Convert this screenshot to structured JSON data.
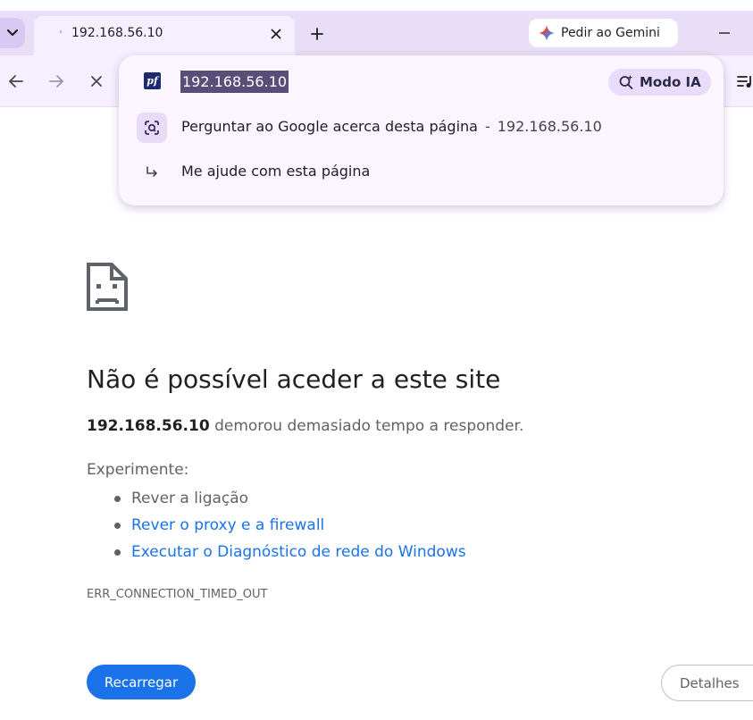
{
  "tabstrip": {
    "tab": {
      "title": "192.168.56.10",
      "favicon": "loading-dot"
    },
    "gemini_button": {
      "label": "Pedir ao Gemini",
      "icon": "gemini-sparkle-icon"
    }
  },
  "omnibox": {
    "url": "192.168.56.10",
    "site_icon_text": "pf",
    "ai_mode_label": "Modo IA",
    "suggestions": [
      {
        "text": "Perguntar ao Google acerca desta página",
        "separator": "-",
        "url": "192.168.56.10",
        "icon": "google-lens-icon"
      },
      {
        "text": "Me ajude com esta página",
        "icon": "arrow-return-icon"
      }
    ]
  },
  "error_page": {
    "title": "Não é possível aceder a este site",
    "host": "192.168.56.10",
    "description_rest": " demorou demasiado tempo a responder.",
    "try_label": "Experimente:",
    "suggestions": [
      {
        "text": "Rever a ligação",
        "type": "text"
      },
      {
        "text": "Rever o proxy e a firewall",
        "type": "link"
      },
      {
        "text": "Executar o Diagnóstico de rede do Windows",
        "type": "link"
      }
    ],
    "error_code": "ERR_CONNECTION_TIMED_OUT",
    "reload_label": "Recarregar",
    "details_label": "Detalhes"
  },
  "colors": {
    "accent": "#1a73e8",
    "tabstrip_bg": "#e8def8",
    "toolbar_bg": "#f6efff"
  }
}
